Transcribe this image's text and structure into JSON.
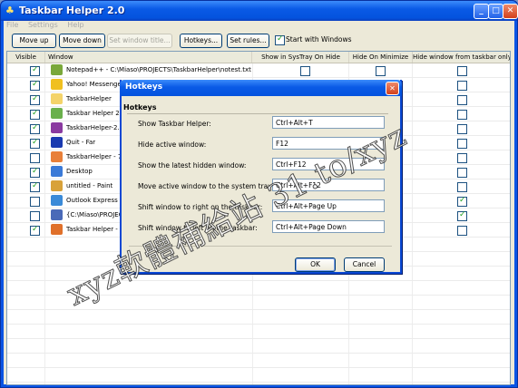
{
  "window": {
    "title": "Taskbar Helper 2.0"
  },
  "menu": [
    "File",
    "Settings",
    "Help"
  ],
  "toolbar": {
    "move_up": "Move up",
    "move_down": "Move down",
    "set_window_title": "Set window title...",
    "hotkeys": "Hotkeys...",
    "set_rules": "Set rules...",
    "start_with_windows": "Start with Windows",
    "start_with_windows_checked": true
  },
  "grid": {
    "columns": [
      "Visible",
      "Window",
      "Show in SysTray On Hide",
      "Hide On Minimize",
      "Hide window from taskbar only"
    ],
    "rows": [
      {
        "visible": true,
        "title": "Notepad++ - C:\\Miaso\\PROJECTS\\TaskbarHelper\\notest.txt",
        "icon": "notepadpp-icon",
        "color": "#7aa83a",
        "systray": false,
        "minimize": false,
        "taskbar_only": false
      },
      {
        "visible": true,
        "title": "Yahoo! Messenger",
        "icon": "yahoo-messenger-icon",
        "color": "#f0c020",
        "systray": false,
        "minimize": false,
        "taskbar_only": false
      },
      {
        "visible": true,
        "title": "TaskbarHelper",
        "icon": "folder-icon",
        "color": "#f4d36a",
        "systray": false,
        "minimize": false,
        "taskbar_only": false
      },
      {
        "visible": true,
        "title": "Taskbar Helper 2",
        "icon": "taskbar-helper-icon",
        "color": "#6ab04c",
        "systray": false,
        "minimize": false,
        "taskbar_only": false
      },
      {
        "visible": true,
        "title": "TaskbarHelper-2.0",
        "icon": "winrar-icon",
        "color": "#8a3aa0",
        "systray": false,
        "minimize": false,
        "taskbar_only": false
      },
      {
        "visible": true,
        "title": "Quit - Far",
        "icon": "far-manager-icon",
        "color": "#1a3ab0",
        "systray": false,
        "minimize": false,
        "taskbar_only": false
      },
      {
        "visible": false,
        "title": "TaskbarHelper - 7",
        "icon": "visual-studio-icon",
        "color": "#e8803a",
        "systray": false,
        "minimize": false,
        "taskbar_only": false
      },
      {
        "visible": true,
        "title": "Desktop",
        "icon": "desktop-icon",
        "color": "#3a7ad8",
        "systray": false,
        "minimize": false,
        "taskbar_only": false
      },
      {
        "visible": true,
        "title": "untitled - Paint",
        "icon": "paint-icon",
        "color": "#d8a23a",
        "systray": false,
        "minimize": false,
        "taskbar_only": false
      },
      {
        "visible": false,
        "title": "Outlook Express",
        "icon": "outlook-express-icon",
        "color": "#3a8ad8",
        "systray": false,
        "minimize": false,
        "taskbar_only": true
      },
      {
        "visible": false,
        "title": "{C:\\Miaso\\PROJECTS\\",
        "icon": "explorer-icon",
        "color": "#4a6ab8",
        "systray": false,
        "minimize": false,
        "taskbar_only": true
      },
      {
        "visible": true,
        "title": "Taskbar Helper -",
        "icon": "firefox-icon",
        "color": "#e0702a",
        "systray": false,
        "minimize": false,
        "taskbar_only": false
      }
    ]
  },
  "hotkeys_dialog": {
    "title": "Hotkeys",
    "group_title": "Hotkeys",
    "items": [
      {
        "label": "Show Taskbar Helper:",
        "value": "Ctrl+Alt+T"
      },
      {
        "label": "Hide active window:",
        "value": "F12"
      },
      {
        "label": "Show the latest hidden window:",
        "value": "Ctrl+F12"
      },
      {
        "label": "Move active window to the system tray:",
        "value": "Ctrl+Alt+F12"
      },
      {
        "label": "Shift window to right on the taskbar:",
        "value": "Ctrl+Alt+Page Up"
      },
      {
        "label": "Shift window to left on the taskbar:",
        "value": "Ctrl+Alt+Page Down"
      }
    ],
    "ok": "OK",
    "cancel": "Cancel"
  },
  "watermark": "xyz軟體補給站 31.to/xyz",
  "colors": {
    "titlebar": "#0a5ae6",
    "window_bg": "#ece9d8",
    "check": "#21a121"
  }
}
